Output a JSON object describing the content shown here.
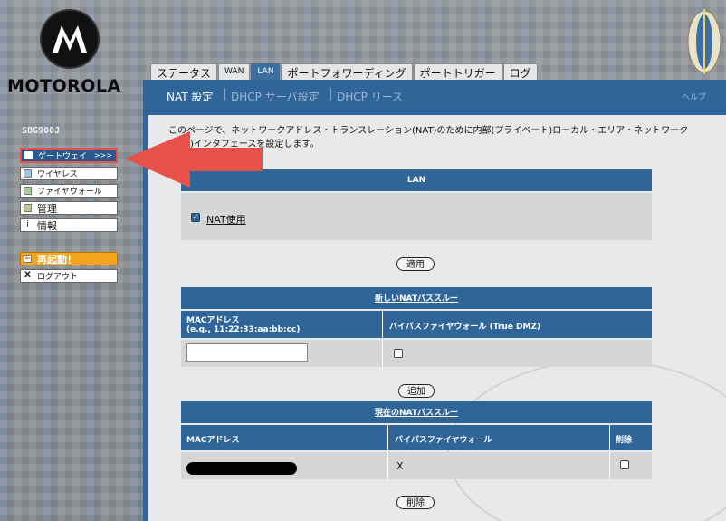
{
  "brand": {
    "name": "MOTOROLA",
    "model": "SBG900J"
  },
  "colors": {
    "accent": "#2f6598",
    "arrow": "#e8504a",
    "restart": "#f4a51c"
  },
  "nav": {
    "items": [
      {
        "label": "ゲートウェイ",
        "arrow": ">>>",
        "icon": "white-square-icon",
        "active": true
      },
      {
        "label": "ワイヤレス",
        "icon": "blue-square-icon"
      },
      {
        "label": "ファイヤウォール",
        "icon": "green-square-icon"
      },
      {
        "label": "管理",
        "icon": "tan-square-icon"
      },
      {
        "label": "情報",
        "icon": "info-icon"
      }
    ],
    "restart": {
      "label": "再起動！",
      "icon": "back-arrow-icon"
    },
    "logout": {
      "label": "ログアウト",
      "icon": "x-icon"
    }
  },
  "tabs": [
    {
      "label": "ステータス"
    },
    {
      "label": "WAN"
    },
    {
      "label": "LAN",
      "active": true
    },
    {
      "label": "ポートフォワーディング"
    },
    {
      "label": "ポートトリガー"
    },
    {
      "label": "ログ"
    }
  ],
  "subtabs": [
    {
      "label": "NAT 設定",
      "active": true
    },
    {
      "label": "DHCP サーバ設定"
    },
    {
      "label": "DHCP リース"
    }
  ],
  "help_label": "ヘルプ",
  "description": "このページで、ネットワークアドレス・トランスレーション(NAT)のために内部(プライベート)ローカル・エリア・ネットワーク(LAN)インタフェースを設定します。",
  "lan_section": {
    "title": "LAN",
    "nat_label": "NAT使用",
    "nat_checked": true,
    "apply_label": "適用"
  },
  "new_passthrough": {
    "title": "新しいNATパススルー",
    "col_mac": "MACアドレス",
    "col_mac_example": "(e.g., 11:22:33:aa:bb:cc)",
    "col_bypass": "バイパスファイヤウォール (True DMZ)",
    "mac_value": "",
    "add_label": "追加"
  },
  "current_passthrough": {
    "title": "現在のNATパススルー",
    "col_mac": "MACアドレス",
    "col_bypass": "バイパスファイヤウォール",
    "col_delete": "削除",
    "rows": [
      {
        "mac": "",
        "bypass": "X"
      }
    ],
    "delete_label": "削除"
  }
}
